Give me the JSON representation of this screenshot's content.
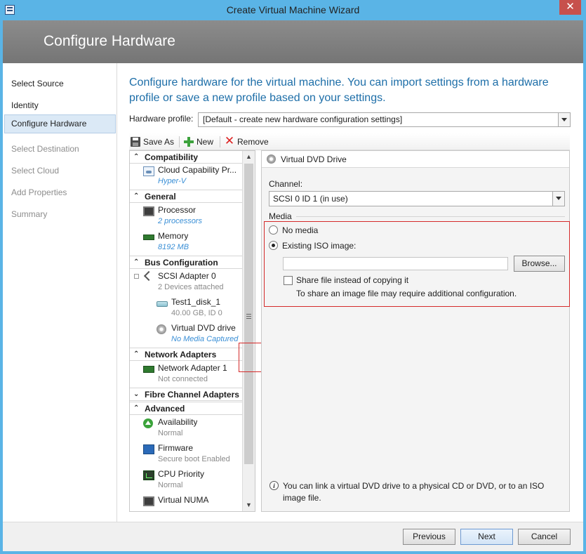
{
  "window": {
    "title": "Create Virtual Machine Wizard",
    "close_glyph": "✕"
  },
  "banner": {
    "title": "Configure Hardware"
  },
  "nav": {
    "items": [
      {
        "label": "Select Source",
        "state": "done"
      },
      {
        "label": "Identity",
        "state": "done"
      },
      {
        "label": "Configure Hardware",
        "state": "active"
      },
      {
        "label": "Select Destination",
        "state": "pending"
      },
      {
        "label": "Select Cloud",
        "state": "pending"
      },
      {
        "label": "Add Properties",
        "state": "pending"
      },
      {
        "label": "Summary",
        "state": "pending"
      }
    ]
  },
  "main": {
    "intro": "Configure hardware for the virtual machine. You can import settings from a hardware profile or save a new profile based on your settings.",
    "hardware_profile": {
      "label": "Hardware profile:",
      "value": "[Default - create new hardware configuration settings]"
    },
    "toolbar": {
      "save_as": "Save As",
      "new": "New",
      "remove": "Remove"
    }
  },
  "tree": {
    "groups": {
      "compatibility": "Compatibility",
      "general": "General",
      "bus": "Bus Configuration",
      "network": "Network Adapters",
      "fibre": "Fibre Channel Adapters",
      "advanced": "Advanced"
    },
    "items": {
      "cloud": {
        "name": "Cloud Capability Pr...",
        "sub": "Hyper-V"
      },
      "processor": {
        "name": "Processor",
        "sub": "2 processors"
      },
      "memory": {
        "name": "Memory",
        "sub": "8192 MB"
      },
      "scsi": {
        "name": "SCSI Adapter 0",
        "sub": "2 Devices attached"
      },
      "disk": {
        "name": "Test1_disk_1",
        "sub": "40.00 GB, ID 0"
      },
      "dvd": {
        "name": "Virtual DVD drive",
        "sub": "No Media Captured"
      },
      "netadapter": {
        "name": "Network Adapter 1",
        "sub": "Not connected"
      },
      "availability": {
        "name": "Availability",
        "sub": "Normal"
      },
      "firmware": {
        "name": "Firmware",
        "sub": "Secure boot Enabled"
      },
      "cpu_priority": {
        "name": "CPU Priority",
        "sub": "Normal"
      },
      "numa": {
        "name": "Virtual NUMA"
      }
    }
  },
  "panel": {
    "title": "Virtual DVD Drive",
    "channel": {
      "label": "Channel:",
      "value": "SCSI 0 ID 1 (in use)"
    },
    "media": {
      "label": "Media",
      "no_media": "No media",
      "existing_iso": "Existing ISO image:",
      "selected": "existing_iso",
      "iso_path": "",
      "browse": "Browse...",
      "share_label": "Share file instead of copying it",
      "share_checked": false,
      "share_note": "To share an image file may require additional configuration."
    },
    "info": "You can link a virtual DVD drive to a physical CD or DVD, or to an ISO image file."
  },
  "footer": {
    "previous": "Previous",
    "next": "Next",
    "cancel": "Cancel"
  },
  "colors": {
    "accent": "#1d6ea8",
    "titlebar": "#5ab4e6",
    "highlight_border": "#d42a2a",
    "link": "#3a8fd6"
  }
}
